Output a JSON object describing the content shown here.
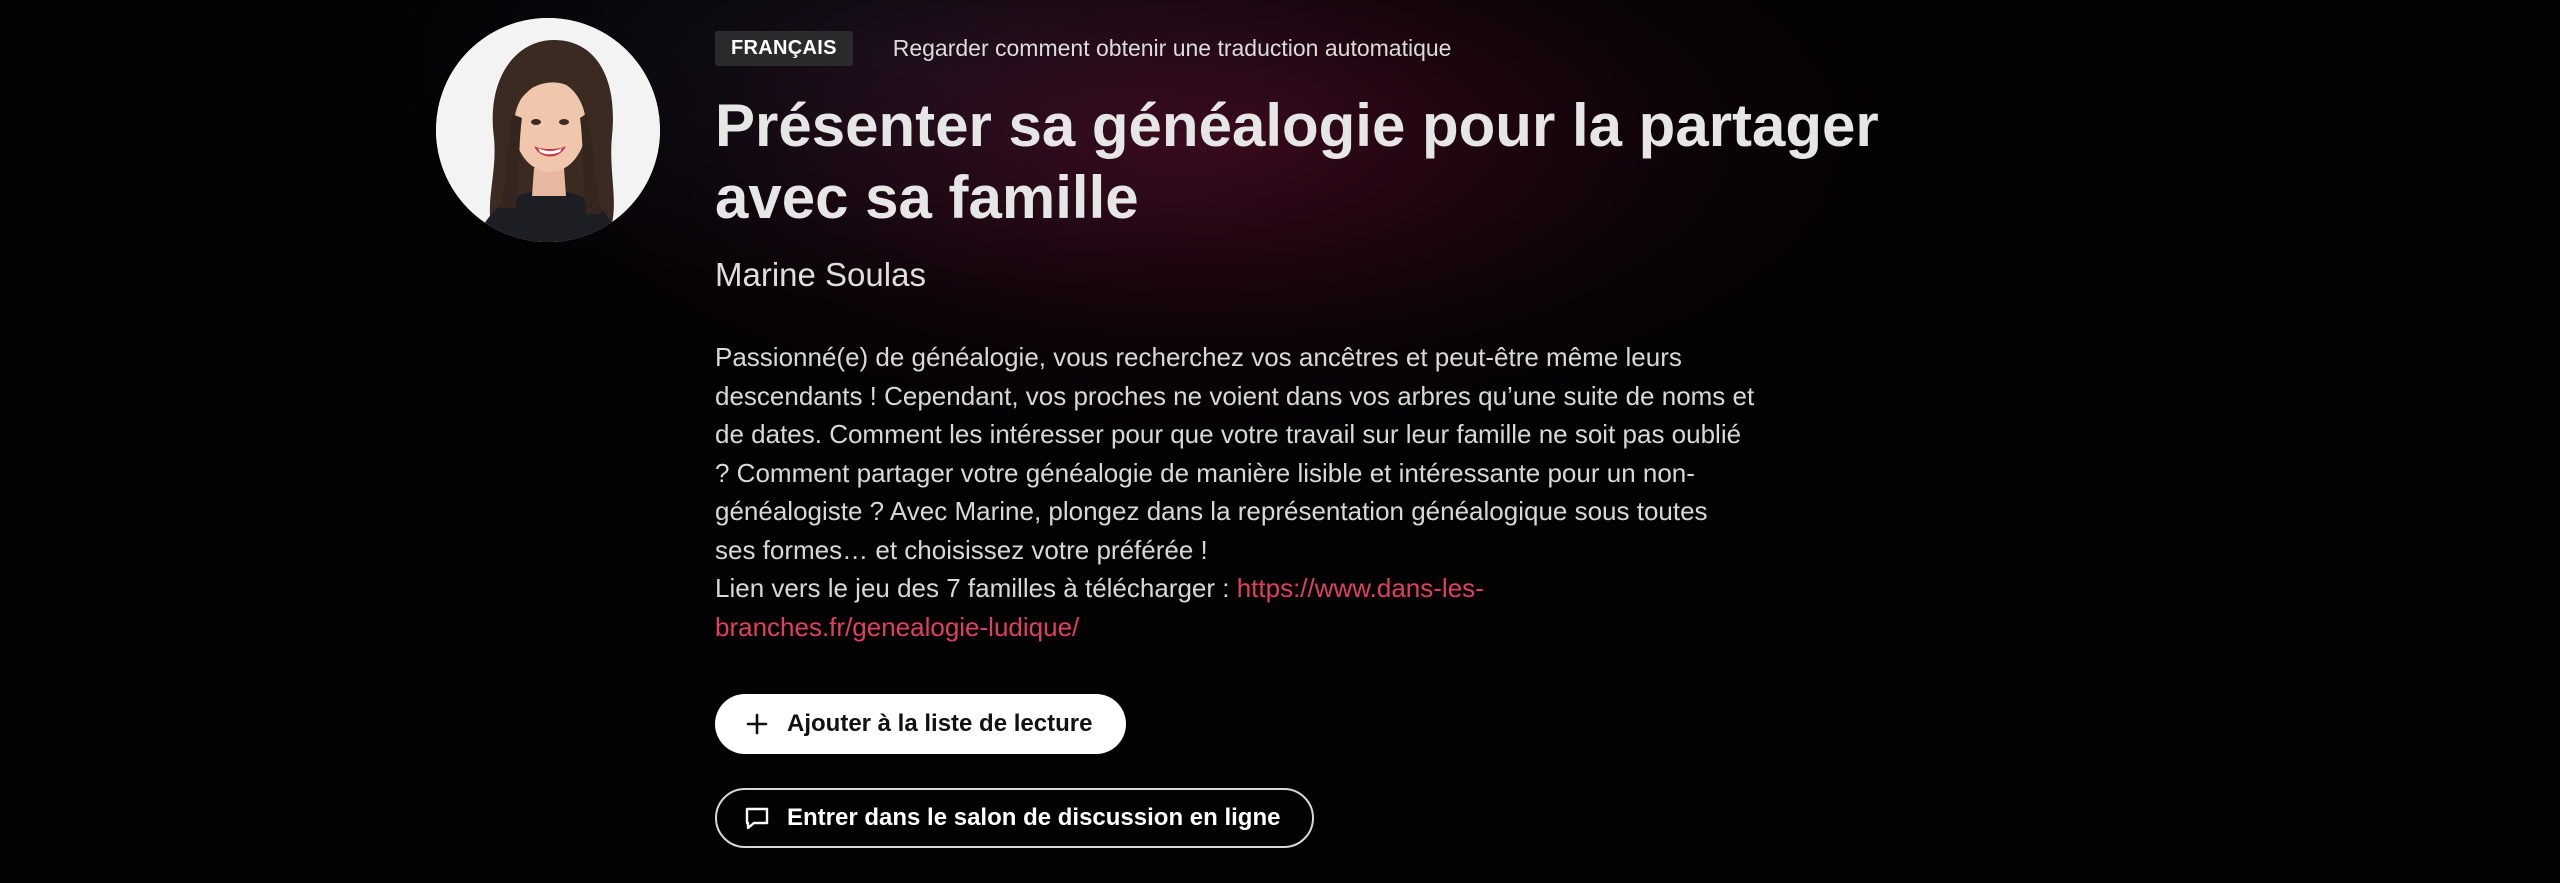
{
  "session": {
    "language_badge": "FRANÇAIS",
    "translation_link": "Regarder comment obtenir une traduction automatique",
    "title": "Présenter sa généalogie pour la partager avec sa famille",
    "speaker": "Marine Soulas",
    "description": "Passionné(e) de généalogie, vous recherchez vos ancêtres et peut-être même leurs descendants ! Cependant, vos proches ne voient dans vos arbres qu’une suite de noms et de dates. Comment les intéresser pour que votre travail sur leur famille ne soit pas oublié ? Comment partager votre généalogie de manière lisible et intéressante pour un non-généalogiste ? Avec Marine, plongez dans la représentation généalogique sous toutes ses formes… et choisissez votre préférée !",
    "download_prefix": "Lien vers le jeu des 7 familles à télécharger : ",
    "download_url": "https://www.dans-les-branches.fr/genealogie-ludique/"
  },
  "actions": {
    "add_to_list": "Ajouter à la liste de lecture",
    "enter_chat": "Entrer dans le salon de discussion en ligne"
  },
  "icons": {
    "add": "plus-icon",
    "chat": "chat-bubble-icon"
  },
  "colors": {
    "link": "#e0405f",
    "primary_button_bg": "#ffffff",
    "badge_bg": "#2b2b2d"
  }
}
